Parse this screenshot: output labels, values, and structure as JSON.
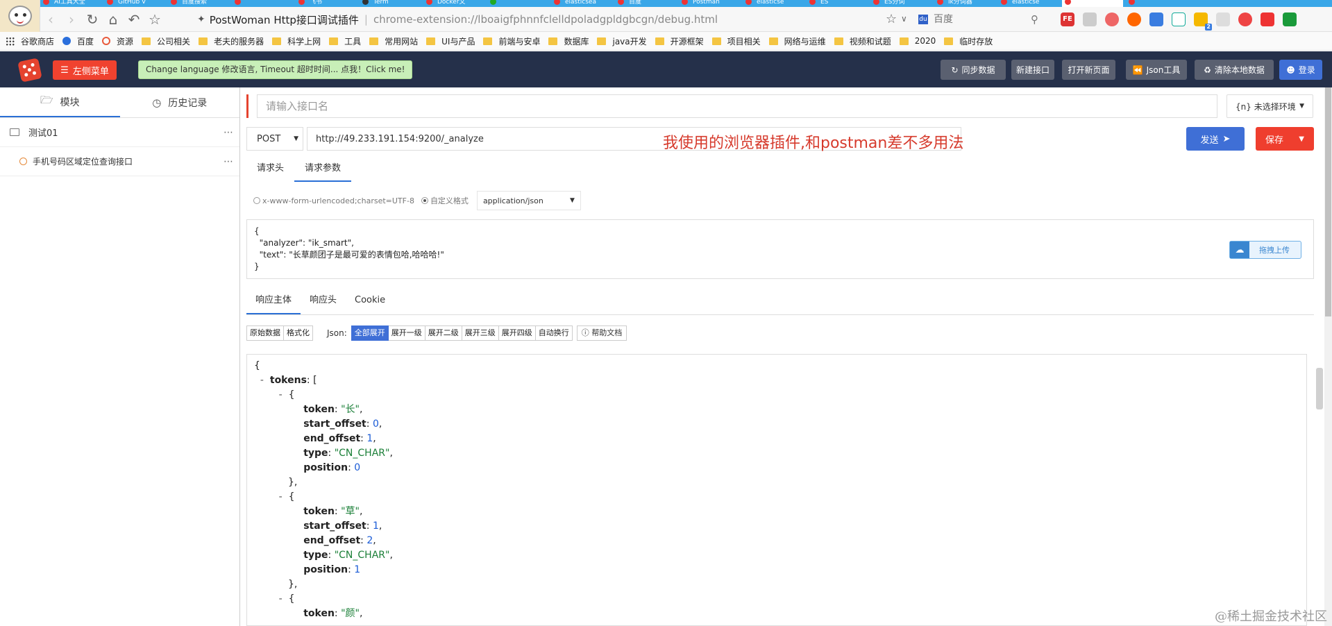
{
  "browser": {
    "tabs": [
      {
        "label": "AI工具大全",
        "color": "#e33"
      },
      {
        "label": "GitHub V",
        "color": "#e33"
      },
      {
        "label": "百度搜索",
        "color": "#e33"
      },
      {
        "label": "",
        "color": "#e33"
      },
      {
        "label": "飞书",
        "color": "#e33"
      },
      {
        "label": "Term",
        "color": "#333"
      },
      {
        "label": "Docker文",
        "color": "#e33"
      },
      {
        "label": "",
        "color": "#2a2"
      },
      {
        "label": "elasticsea",
        "color": "#e33"
      },
      {
        "label": "百度",
        "color": "#e33"
      },
      {
        "label": "Postman",
        "color": "#e33"
      },
      {
        "label": "elasticse",
        "color": "#e33"
      },
      {
        "label": "ES",
        "color": "#e33"
      },
      {
        "label": "ES分词",
        "color": "#e33"
      },
      {
        "label": "ik分词器",
        "color": "#e33"
      },
      {
        "label": "elasticse",
        "color": "#e33"
      },
      {
        "label": "",
        "color": "#e33"
      },
      {
        "label": "",
        "color": "#e33"
      }
    ],
    "page_title": "PostWoman Http接口调试插件",
    "url": "chrome-extension://lboaigfphnnfclelldpoladgpldgbcgn/debug.html",
    "search_placeholder": "百度",
    "ext_badge": "2"
  },
  "bookmarks": [
    {
      "label": "谷歌商店",
      "icon": "grid"
    },
    {
      "label": "百度",
      "icon": "paw"
    },
    {
      "label": "资源",
      "icon": "gear"
    },
    {
      "label": "公司相关",
      "icon": "folder"
    },
    {
      "label": "老夫的服务器",
      "icon": "folder"
    },
    {
      "label": "科学上网",
      "icon": "folder"
    },
    {
      "label": "工具",
      "icon": "folder"
    },
    {
      "label": "常用网站",
      "icon": "folder"
    },
    {
      "label": "UI与产品",
      "icon": "folder"
    },
    {
      "label": "前端与安卓",
      "icon": "folder"
    },
    {
      "label": "数据库",
      "icon": "folder"
    },
    {
      "label": "java开发",
      "icon": "folder"
    },
    {
      "label": "开源框架",
      "icon": "folder"
    },
    {
      "label": "项目相关",
      "icon": "folder"
    },
    {
      "label": "网络与运维",
      "icon": "folder"
    },
    {
      "label": "视频和试题",
      "icon": "folder"
    },
    {
      "label": "2020",
      "icon": "folder"
    },
    {
      "label": "临时存放",
      "icon": "folder"
    }
  ],
  "header": {
    "menu_label": "左侧菜单",
    "notice": "Change language 修改语言, Timeout 超时时间... 点我！Click me!",
    "sync_label": "同步数据",
    "new_api_label": "新建接口",
    "open_page_label": "打开新页面",
    "json_tool_label": "Json工具",
    "clear_label": "清除本地数据",
    "login_label": "登录"
  },
  "sidebar": {
    "tab_modules": "模块",
    "tab_history": "历史记录",
    "folder": "测试01",
    "api_item": "手机号码区域定位查询接口"
  },
  "request": {
    "name_placeholder": "请输入接口名",
    "env_label": "{n} 未选择环境",
    "method": "POST",
    "url": "http://49.233.191.154:9200/_analyze",
    "annotation": "我使用的浏览器插件,和postman差不多用法",
    "send_label": "发送",
    "save_label": "保存",
    "tab_headers": "请求头",
    "tab_params": "请求参数",
    "opt_form": "x-www-form-urlencoded;charset=UTF-8",
    "opt_custom": "自定义格式",
    "content_type": "application/json",
    "body_lines": [
      "{",
      "  \"analyzer\": \"ik_smart\",",
      "  \"text\": \"长草颜团子是最可爱的表情包哈,哈哈哈!\"",
      "}"
    ],
    "upload_label": "拖拽上传"
  },
  "response": {
    "tab_body": "响应主体",
    "tab_headers": "响应头",
    "tab_cookie": "Cookie",
    "btn_raw": "原始数据",
    "btn_format": "格式化",
    "json_label": "Json:",
    "btn_expand_all": "全部展开",
    "btn_expand_1": "展开一级",
    "btn_expand_2": "展开二级",
    "btn_expand_3": "展开三级",
    "btn_expand_4": "展开四级",
    "btn_wrap": "自动换行",
    "btn_help": "帮助文档",
    "root_key": "tokens",
    "tokens": [
      {
        "token": "\"长\"",
        "start_offset": "0",
        "end_offset": "1",
        "type": "\"CN_CHAR\"",
        "position": "0"
      },
      {
        "token": "\"草\"",
        "start_offset": "1",
        "end_offset": "2",
        "type": "\"CN_CHAR\"",
        "position": "1"
      },
      {
        "token": "\"颜\""
      }
    ]
  },
  "watermark": "@稀土掘金技术社区"
}
